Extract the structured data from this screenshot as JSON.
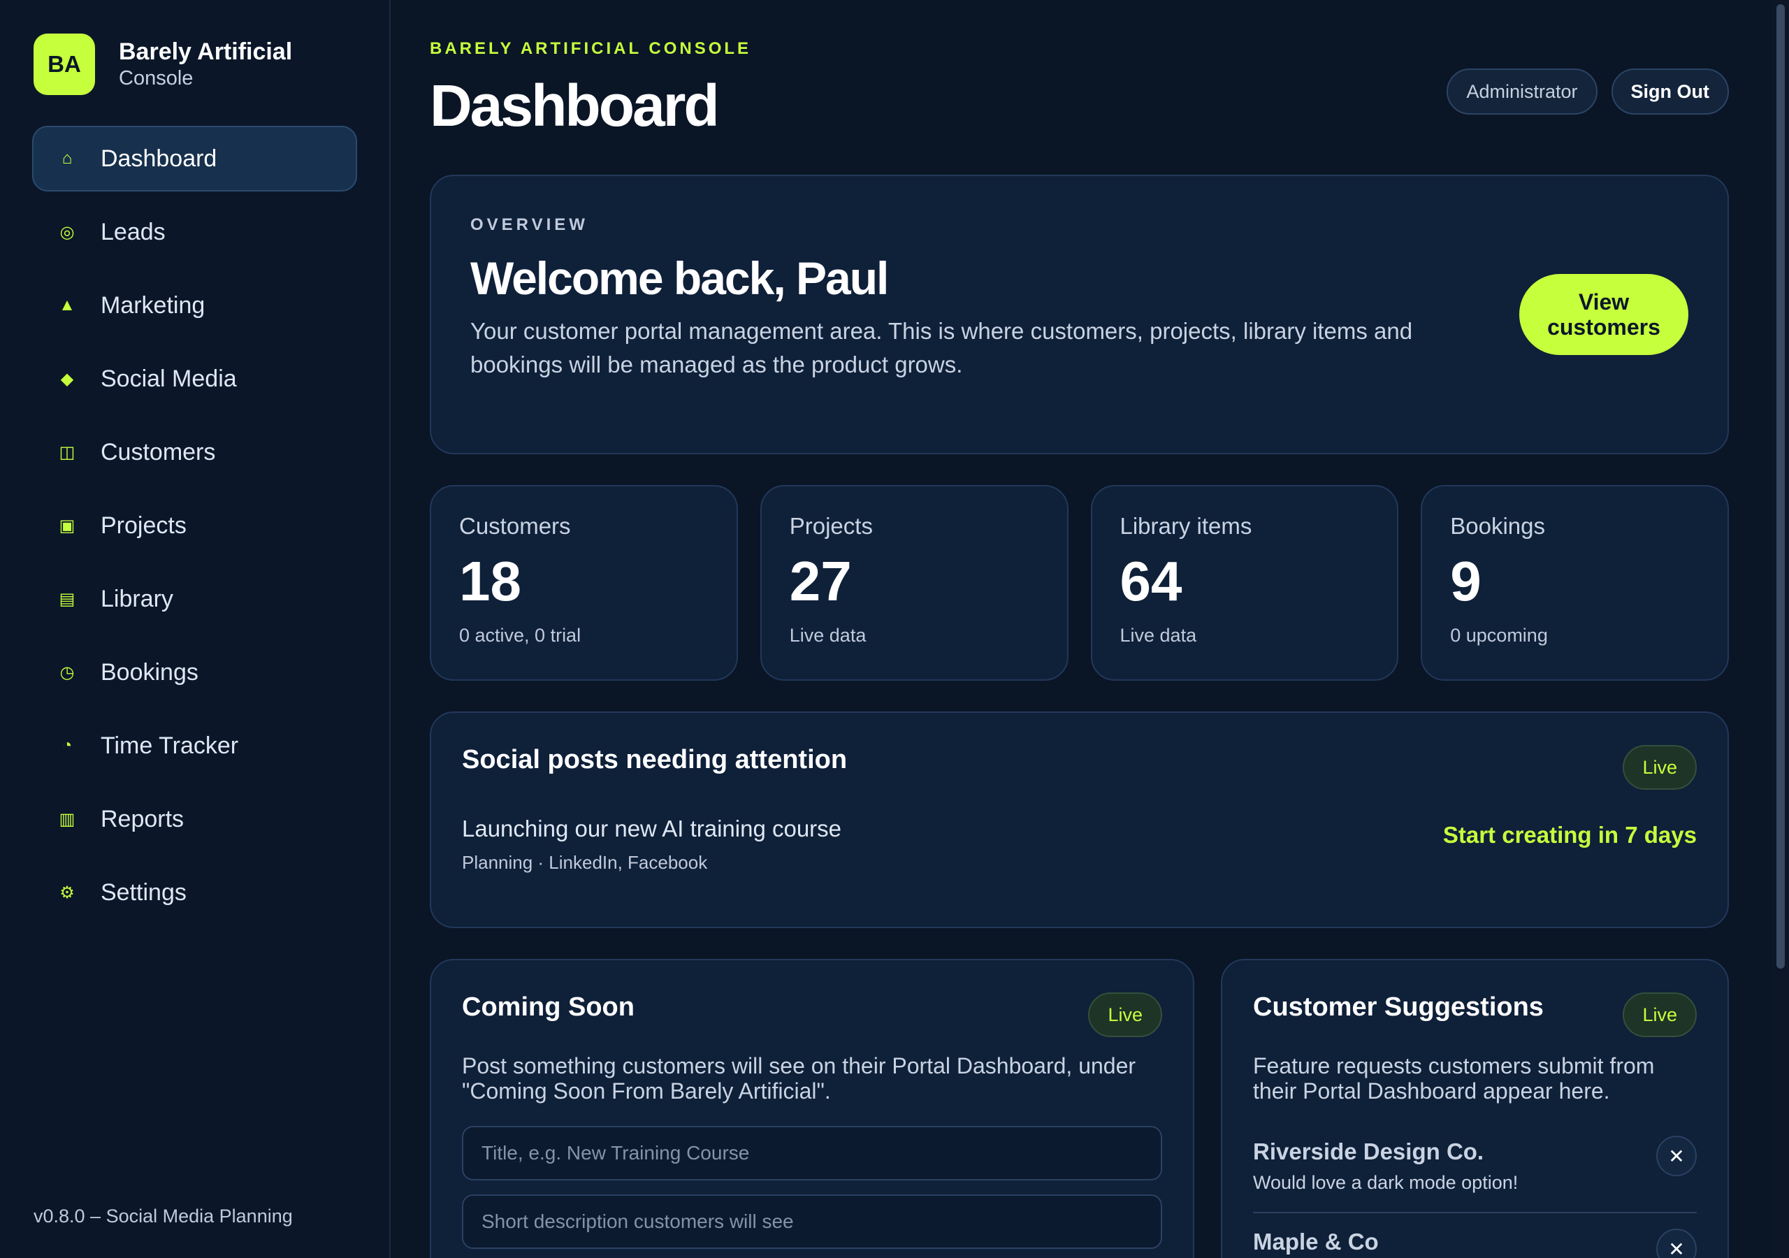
{
  "brand": {
    "logo": "BA",
    "name": "Barely Artificial",
    "sub": "Console"
  },
  "nav": {
    "items": [
      {
        "label": "Dashboard",
        "icon": "home-icon",
        "glyph": "⌂"
      },
      {
        "label": "Leads",
        "icon": "target-icon",
        "glyph": "◎"
      },
      {
        "label": "Marketing",
        "icon": "triangle-icon",
        "glyph": "▲"
      },
      {
        "label": "Social Media",
        "icon": "diamond-icon",
        "glyph": "◆"
      },
      {
        "label": "Customers",
        "icon": "customers-icon",
        "glyph": "◫"
      },
      {
        "label": "Projects",
        "icon": "projects-icon",
        "glyph": "▣"
      },
      {
        "label": "Library",
        "icon": "library-icon",
        "glyph": "▤"
      },
      {
        "label": "Bookings",
        "icon": "clock-icon",
        "glyph": "◷"
      },
      {
        "label": "Time Tracker",
        "icon": "timer-icon",
        "glyph": "◔"
      },
      {
        "label": "Reports",
        "icon": "reports-icon",
        "glyph": "▥"
      },
      {
        "label": "Settings",
        "icon": "gear-icon",
        "glyph": "⚙"
      }
    ]
  },
  "footer": {
    "version": "v0.8.0 – Social Media Planning"
  },
  "header": {
    "eyebrow": "BARELY ARTIFICIAL CONSOLE",
    "title": "Dashboard",
    "role": "Administrator",
    "signout": "Sign Out"
  },
  "overview": {
    "eyebrow": "OVERVIEW",
    "title": "Welcome back, Paul",
    "desc": "Your customer portal management area. This is where customers, projects, library items and bookings will be managed as the product grows.",
    "cta_line1": "View",
    "cta_line2": "customers"
  },
  "stats": [
    {
      "label": "Customers",
      "value": "18",
      "sub": "0 active, 0 trial"
    },
    {
      "label": "Projects",
      "value": "27",
      "sub": "Live data"
    },
    {
      "label": "Library items",
      "value": "64",
      "sub": "Live data"
    },
    {
      "label": "Bookings",
      "value": "9",
      "sub": "0 upcoming"
    }
  ],
  "social": {
    "title": "Social posts needing attention",
    "badge": "Live",
    "post_title": "Launching our new AI training course",
    "post_meta": "Planning · LinkedIn, Facebook",
    "post_cta": "Start creating in 7 days"
  },
  "coming": {
    "title": "Coming Soon",
    "badge": "Live",
    "desc": "Post something customers will see on their Portal Dashboard, under \"Coming Soon From Barely Artificial\".",
    "title_placeholder": "Title, e.g. New Training Course",
    "desc_placeholder": "Short description customers will see"
  },
  "suggestions": {
    "title": "Customer Suggestions",
    "badge": "Live",
    "desc": "Feature requests customers submit from their Portal Dashboard appear here.",
    "items": [
      {
        "name": "Riverside Design Co.",
        "text": "Would love a dark mode option!"
      },
      {
        "name": "Maple & Co",
        "text": ""
      }
    ]
  },
  "colors": {
    "accent": "#c6ff3c",
    "background": "#0a1526",
    "card": "#0f2039"
  }
}
